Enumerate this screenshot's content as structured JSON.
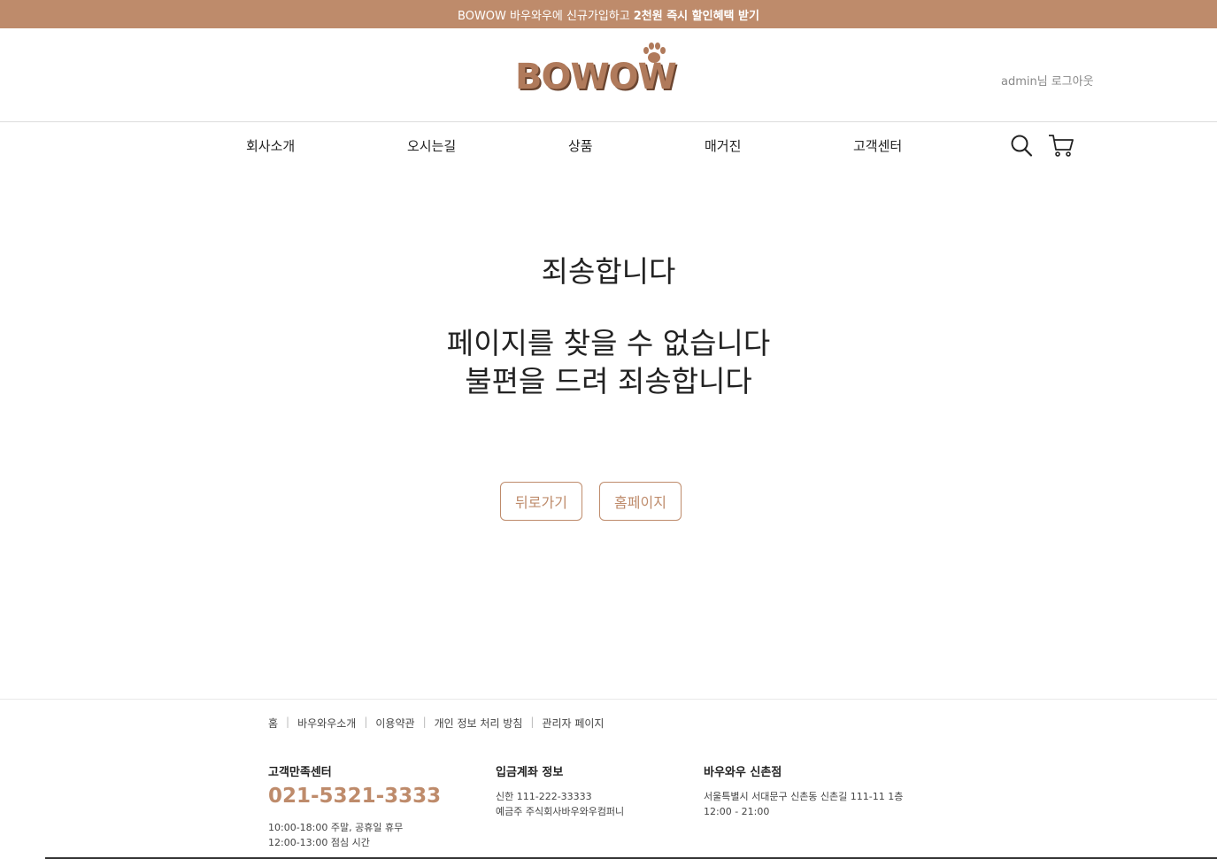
{
  "banner": {
    "text": "BOWOW 바우와우에 신규가입하고",
    "highlight": "2천원 즉시 할인혜택 받기"
  },
  "header": {
    "logo_text": "BOWOW",
    "user": {
      "name": "admin님",
      "logout": "로그아웃"
    }
  },
  "nav": {
    "items": [
      {
        "label": "회사소개"
      },
      {
        "label": "오시는길"
      },
      {
        "label": "상품"
      },
      {
        "label": "매거진"
      },
      {
        "label": "고객센터"
      }
    ],
    "icons": [
      "search-icon",
      "cart-icon"
    ]
  },
  "error": {
    "title": "죄송합니다",
    "line1": "페이지를 찾을 수 없습니다",
    "line2": "불편을 드려 죄송합니다",
    "back_label": "뒤로가기",
    "home_label": "홈페이지"
  },
  "footer": {
    "links": [
      "홈",
      "바우와우소개",
      "이용약관",
      "개인 정보 처리 방침",
      "관리자 페이지"
    ],
    "support": {
      "title": "고객만족센터",
      "phone": "021-5321-3333",
      "hours1": "10:00-18:00 주말, 공휴일 휴무",
      "hours2": "12:00-13:00 점심 시간"
    },
    "account": {
      "title": "입금계좌 정보",
      "bank": "신한 111-222-33333",
      "holder": "예금주 주식회사바우와우컴퍼니"
    },
    "store": {
      "title": "바우와우 신촌점",
      "address": "서울특별시 서대문구 신촌동 신촌길 111-11 1층",
      "hours": "12:00 - 21:00"
    }
  },
  "colors": {
    "accent": "#be8b6b",
    "logo_shadow": "#6b4530"
  }
}
